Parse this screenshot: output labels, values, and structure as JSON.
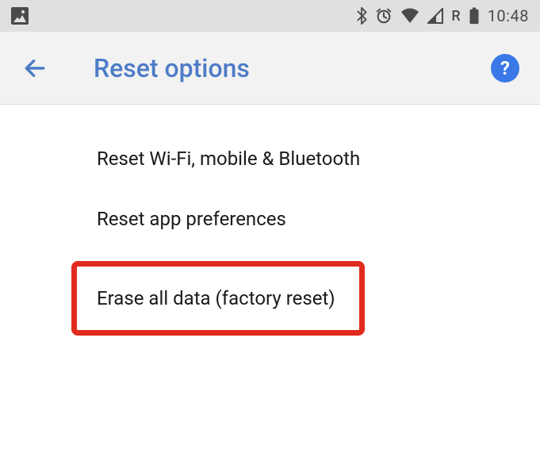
{
  "statusBar": {
    "roaming": "R",
    "time": "10:48"
  },
  "appBar": {
    "title": "Reset options",
    "helpSymbol": "?"
  },
  "options": {
    "item0": "Reset Wi-Fi, mobile & Bluetooth",
    "item1": "Reset app preferences",
    "item2": "Erase all data (factory reset)"
  }
}
